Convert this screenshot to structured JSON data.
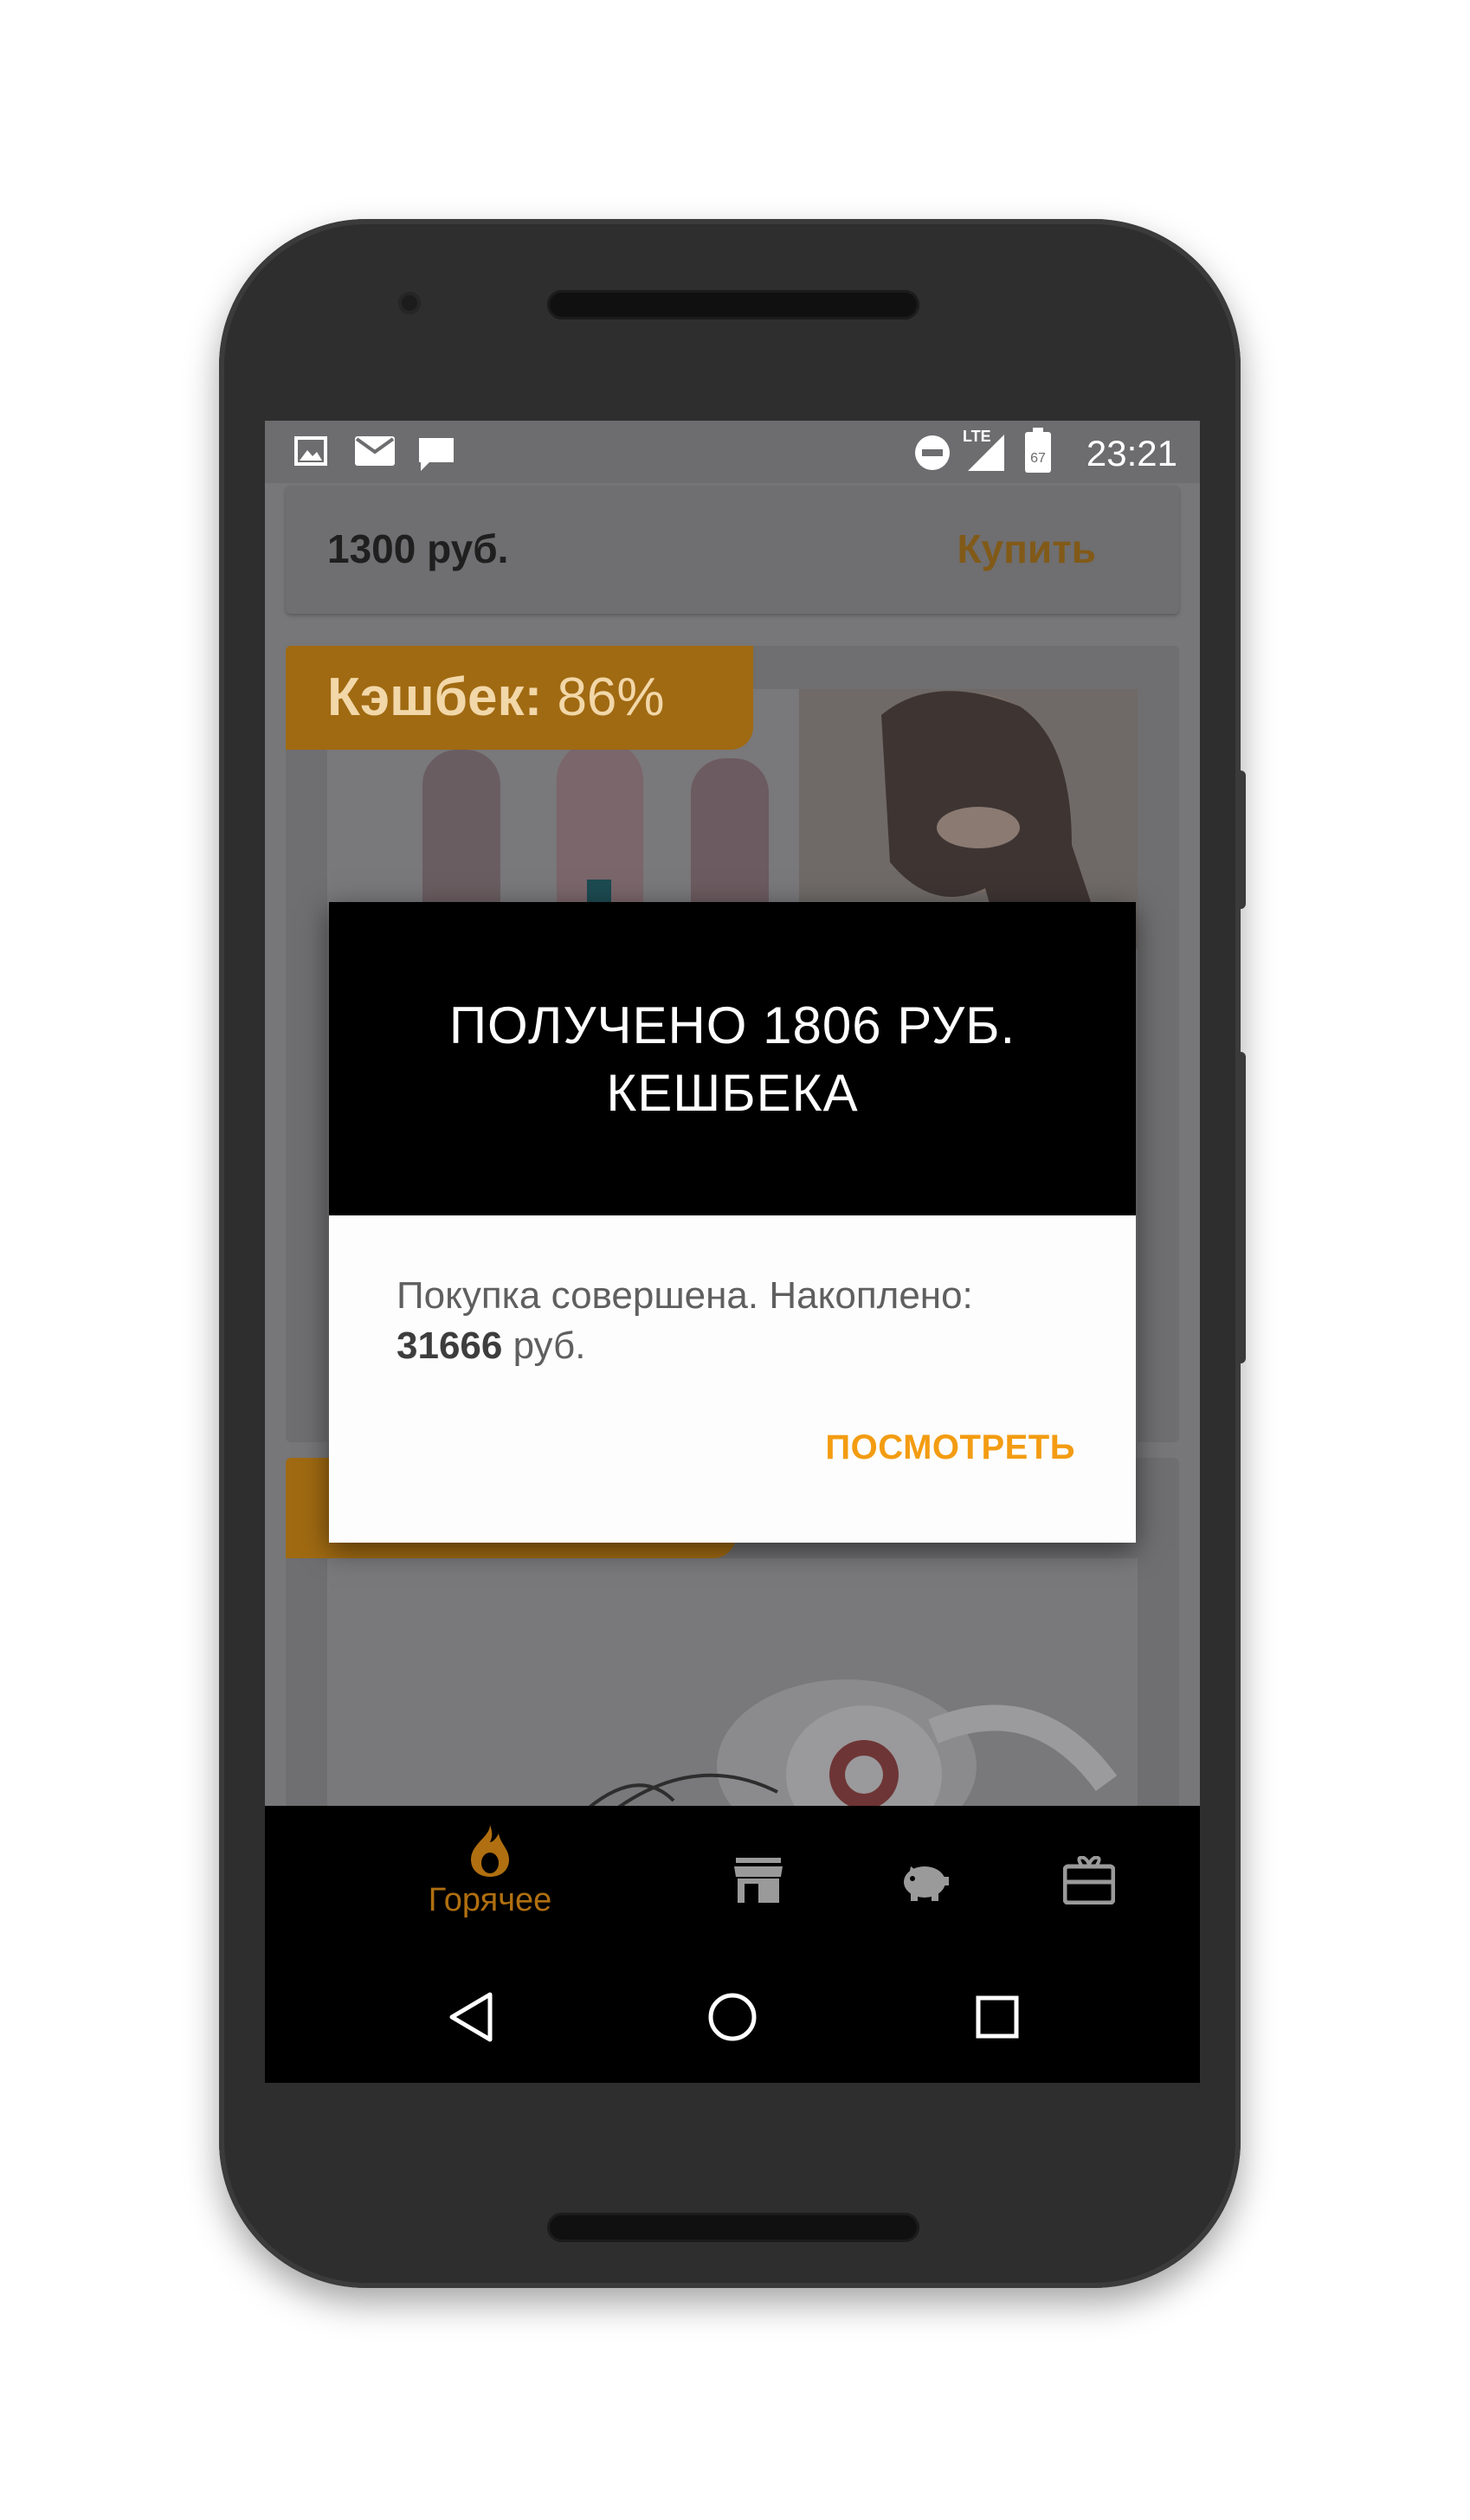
{
  "status_bar": {
    "time": "23:21",
    "network": "LTE",
    "battery_level": "67",
    "icons": [
      "gallery-icon",
      "mail-icon",
      "message-icon",
      "dnd-icon",
      "signal-icon",
      "battery-icon"
    ]
  },
  "offer": {
    "price": "1300 руб.",
    "buy_label": "Купить"
  },
  "products": [
    {
      "badge_label": "Кэшбек:",
      "badge_value": "86%",
      "image": "hair-straightener-brush"
    },
    {
      "badge_label": "",
      "badge_value": "",
      "image": "headphones"
    }
  ],
  "dialog": {
    "title_line1": "ПОЛУЧЕНО 1806 РУБ.",
    "title_line2": "КЕШБЕКА",
    "message_text": "Покупка совершена. Накоплено:",
    "amount": "31666",
    "currency": " руб.",
    "action_label": "ПОСМОТРЕТЬ"
  },
  "tabs": [
    {
      "label": "Горячее",
      "icon": "flame-icon",
      "active": true
    },
    {
      "label": "",
      "icon": "store-icon",
      "active": false
    },
    {
      "label": "",
      "icon": "piggy-bank-icon",
      "active": false
    },
    {
      "label": "",
      "icon": "gift-card-icon",
      "active": false
    }
  ],
  "colors": {
    "accent": "#f39c12",
    "dim_accent": "#815a18",
    "overlay": "#777678"
  }
}
